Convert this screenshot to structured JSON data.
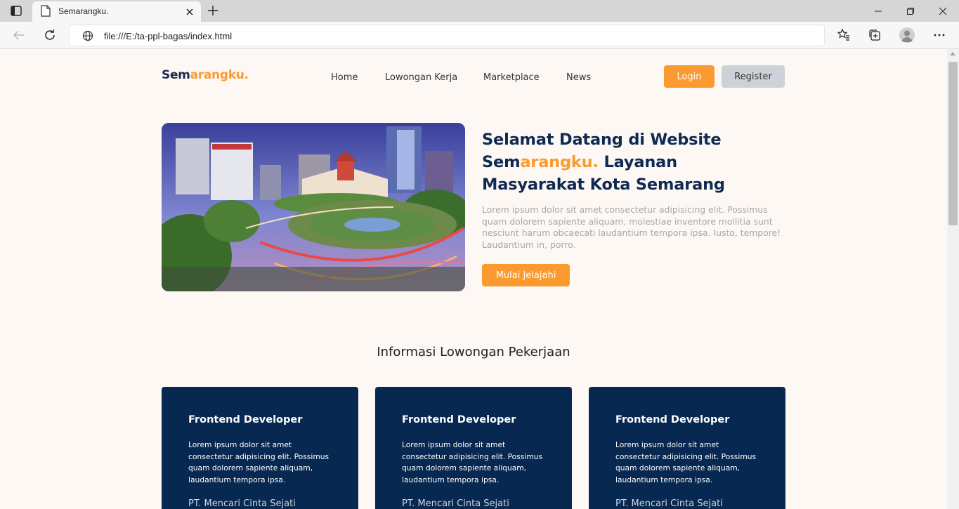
{
  "browser": {
    "tab_title": "Semarangku.",
    "url": "file:///E:/ta-ppl-bagas/index.html"
  },
  "site": {
    "logo_prefix": "Sem",
    "logo_accent": "arangku.",
    "nav": [
      "Home",
      "Lowongan Kerja",
      "Marketplace",
      "News"
    ],
    "login_label": "Login",
    "register_label": "Register"
  },
  "hero": {
    "title_line1": "Selamat Datang di Website",
    "title_brand_prefix": "Sem",
    "title_brand_accent": "arangku.",
    "title_rest": "Layanan Masyarakat Kota Semarang",
    "description": "Lorem ipsum dolor sit amet consectetur adipisicing elit. Possimus quam dolorem sapiente aliquam, molestiae inventore mollitia sunt nesciunt harum obcaecati laudantium tempora ipsa. Iusto, tempore! Laudantium in, porro.",
    "cta_label": "Mulai Jelajahi"
  },
  "jobs": {
    "section_title": "Informasi Lowongan Pekerjaan",
    "cards": [
      {
        "title": "Frontend Developer",
        "description": "Lorem ipsum dolor sit amet consectetur adipisicing elit. Possimus quam dolorem sapiente aliquam, laudantium tempora ipsa.",
        "company": "PT. Mencari Cinta Sejati"
      },
      {
        "title": "Frontend Developer",
        "description": "Lorem ipsum dolor sit amet consectetur adipisicing elit. Possimus quam dolorem sapiente aliquam, laudantium tempora ipsa.",
        "company": "PT. Mencari Cinta Sejati"
      },
      {
        "title": "Frontend Developer",
        "description": "Lorem ipsum dolor sit amet consectetur adipisicing elit. Possimus quam dolorem sapiente aliquam, laudantium tempora ipsa.",
        "company": "PT. Mencari Cinta Sejati"
      }
    ]
  },
  "colors": {
    "accent": "#fb9a2e",
    "navy": "#072851",
    "page_bg": "#fdf8f4"
  },
  "icons": [
    "tab-actions-icon",
    "page-icon",
    "close-icon",
    "plus-icon",
    "minimize-icon",
    "restore-icon",
    "back-icon",
    "refresh-icon",
    "globe-icon",
    "favorites-icon",
    "collections-icon",
    "profile-icon",
    "more-icon"
  ]
}
